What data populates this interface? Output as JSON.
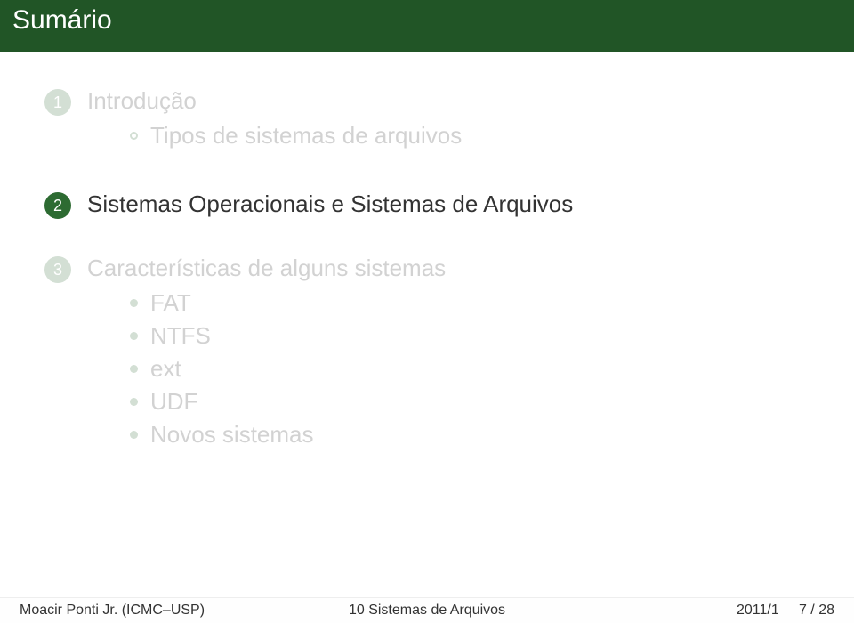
{
  "title": "Sumário",
  "sections": [
    {
      "number": "1",
      "label": "Introdução",
      "active": false,
      "subitems": [
        "Tipos de sistemas de arquivos"
      ]
    },
    {
      "number": "2",
      "label": "Sistemas Operacionais e Sistemas de Arquivos",
      "active": true,
      "subitems": []
    },
    {
      "number": "3",
      "label": "Características de alguns sistemas",
      "active": false,
      "subitems": [
        "FAT",
        "NTFS",
        "ext",
        "UDF",
        "Novos sistemas"
      ]
    }
  ],
  "footer": {
    "author": "Moacir Ponti Jr. (ICMC–USP)",
    "title": "10 Sistemas de Arquivos",
    "page": "2011/1     7 / 28"
  }
}
